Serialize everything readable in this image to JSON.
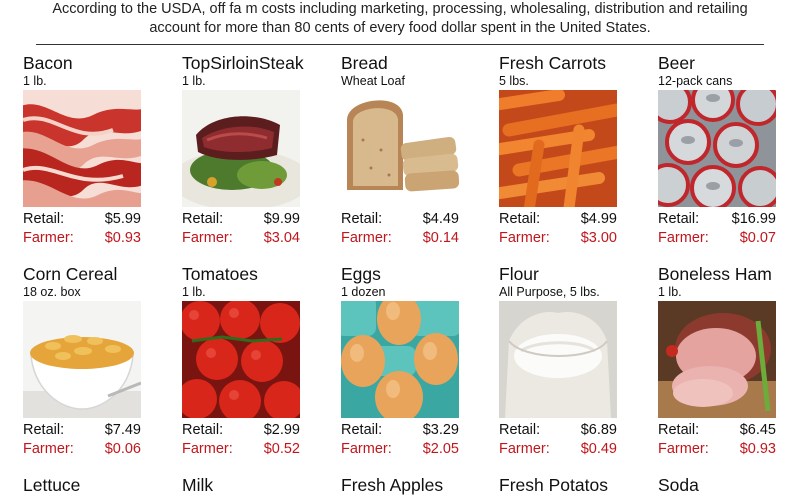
{
  "intro": "According to the USDA, off fa m costs including marketing, processing, wholesaling, distribution and retailing account for more than 80 cents of every food dollar spent in the United States.",
  "labels": {
    "retail": "Retail:",
    "farmer": "Farmer:"
  },
  "colors": {
    "farmer_text": "#c0161c",
    "retail_text": "#111111",
    "rule": "#333333"
  },
  "items": [
    {
      "name": "Bacon",
      "qty": "1 lb.",
      "retail": "$5.99",
      "farmer": "$0.93",
      "image": "bacon-image"
    },
    {
      "name": "TopSirloinSteak",
      "qty": "1 lb.",
      "retail": "$9.99",
      "farmer": "$3.04",
      "image": "steak-image"
    },
    {
      "name": "Bread",
      "qty": "Wheat Loaf",
      "retail": "$4.49",
      "farmer": "$0.14",
      "image": "bread-image"
    },
    {
      "name": "Fresh Carrots",
      "qty": "5 lbs.",
      "retail": "$4.99",
      "farmer": "$3.00",
      "image": "carrots-image"
    },
    {
      "name": "Beer",
      "qty": "12-pack cans",
      "retail": "$16.99",
      "farmer": "$0.07",
      "image": "beer-cans-image"
    },
    {
      "name": "Corn Cereal",
      "qty": "18 oz. box",
      "retail": "$7.49",
      "farmer": "$0.06",
      "image": "cereal-image"
    },
    {
      "name": "Tomatoes",
      "qty": "1 lb.",
      "retail": "$2.99",
      "farmer": "$0.52",
      "image": "tomatoes-image"
    },
    {
      "name": "Eggs",
      "qty": "1 dozen",
      "retail": "$3.29",
      "farmer": "$2.05",
      "image": "eggs-image"
    },
    {
      "name": "Flour",
      "qty": "All Purpose, 5 lbs.",
      "retail": "$6.89",
      "farmer": "$0.49",
      "image": "flour-image"
    },
    {
      "name": "Boneless Ham",
      "qty": "1 lb.",
      "retail": "$6.45",
      "farmer": "$0.93",
      "image": "ham-image"
    },
    {
      "name": "Lettuce",
      "qty": "",
      "retail": "",
      "farmer": "",
      "image": ""
    },
    {
      "name": "Milk",
      "qty": "",
      "retail": "",
      "farmer": "",
      "image": ""
    },
    {
      "name": "Fresh Apples",
      "qty": "",
      "retail": "",
      "farmer": "",
      "image": ""
    },
    {
      "name": "Fresh Potatos",
      "qty": "",
      "retail": "",
      "farmer": "",
      "image": ""
    },
    {
      "name": "Soda",
      "qty": "",
      "retail": "",
      "farmer": "",
      "image": ""
    }
  ]
}
